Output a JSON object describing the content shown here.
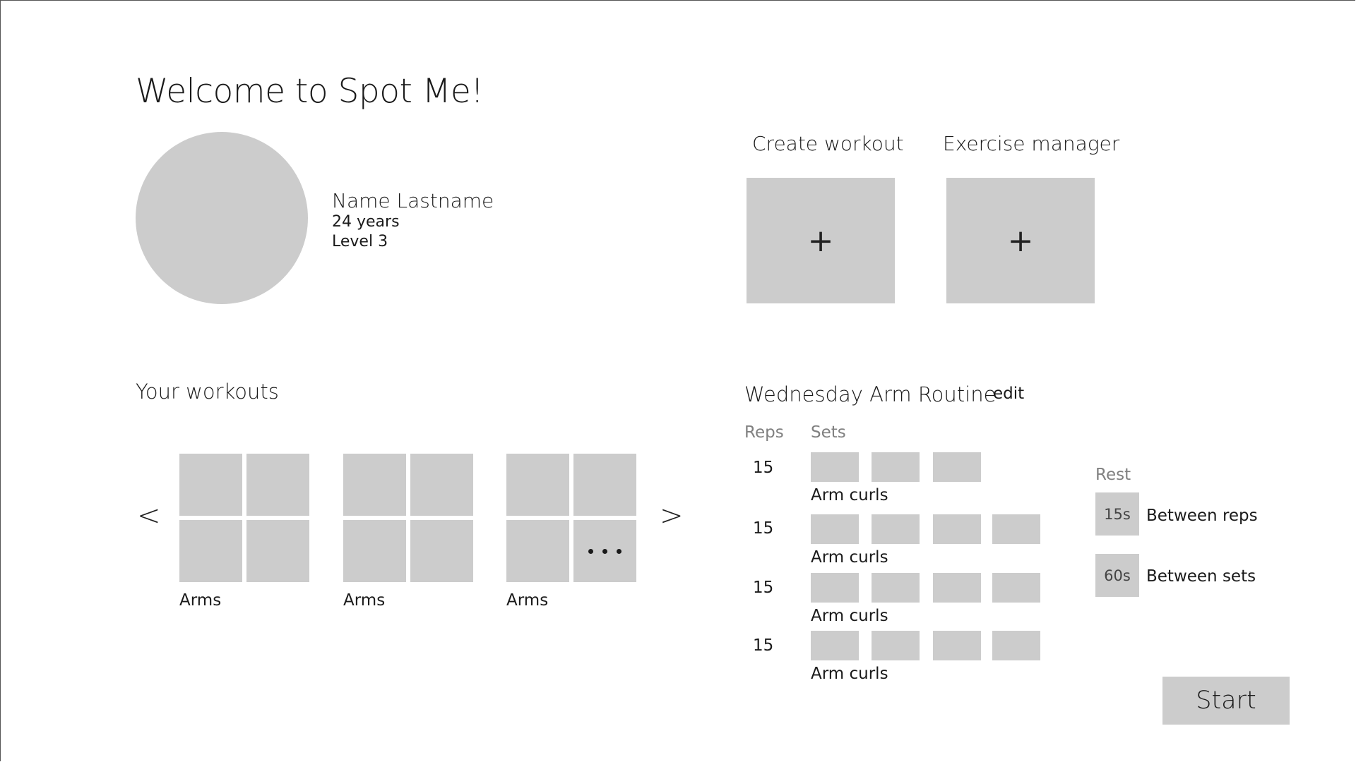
{
  "header": {
    "title": "Welcome to Spot Me!"
  },
  "profile": {
    "name": "Name Lastname",
    "age": "24 years",
    "level": "Level 3"
  },
  "actions": {
    "create_label": "Create workout",
    "create_icon": "+",
    "manager_label": "Exercise manager",
    "manager_icon": "+"
  },
  "workouts": {
    "title": "Your workouts",
    "prev": "<",
    "next": ">",
    "items": [
      {
        "label": "Arms"
      },
      {
        "label": "Arms"
      },
      {
        "label": "Arms"
      }
    ]
  },
  "routine": {
    "title": "Wednesday Arm Routine",
    "edit": "edit",
    "reps_header": "Reps",
    "sets_header": "Sets",
    "exercises": [
      {
        "reps": "15",
        "name": "Arm curls",
        "sets": 3
      },
      {
        "reps": "15",
        "name": "Arm curls",
        "sets": 4
      },
      {
        "reps": "15",
        "name": "Arm curls",
        "sets": 4
      },
      {
        "reps": "15",
        "name": "Arm curls",
        "sets": 4
      }
    ]
  },
  "rest": {
    "title": "Rest",
    "between_reps_value": "15s",
    "between_reps_label": "Between reps",
    "between_sets_value": "60s",
    "between_sets_label": "Between sets"
  },
  "start_label": "Start"
}
